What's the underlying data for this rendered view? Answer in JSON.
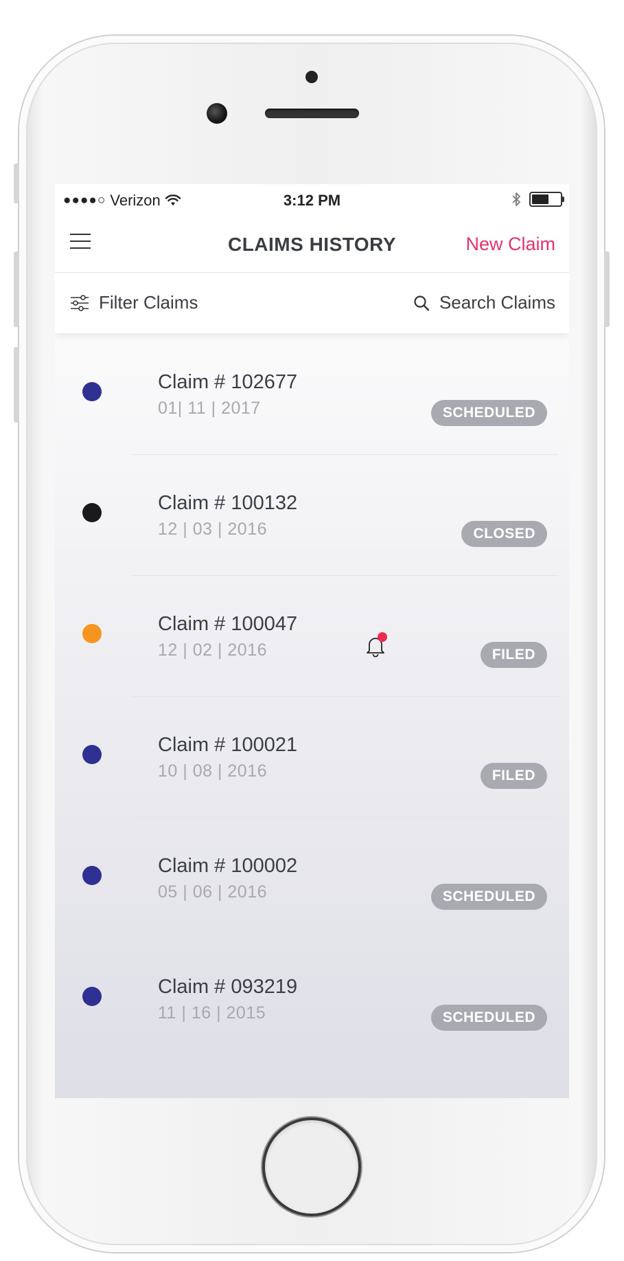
{
  "status_bar": {
    "signal_dots": "●●●●○",
    "carrier": "Verizon",
    "time": "3:12 PM",
    "icons": [
      "wifi-icon",
      "bluetooth-icon",
      "battery-icon"
    ]
  },
  "nav": {
    "title": "CLAIMS HISTORY",
    "new_claim_label": "New Claim",
    "menu_icon": "hamburger-menu-icon"
  },
  "toolbar": {
    "filter_label": "Filter Claims",
    "search_label": "Search Claims"
  },
  "colors": {
    "accent": "#e4336b",
    "indicator_blue": "#2e3192",
    "indicator_black": "#1a1a1a",
    "indicator_orange": "#f7941d",
    "badge_gray": "#a9aab1",
    "notification_red": "#ef2a50"
  },
  "claims": [
    {
      "title": "Claim # 102677",
      "date": "01| 11 | 2017",
      "status": "SCHEDULED",
      "indicator": "#2e3192",
      "has_notification": false
    },
    {
      "title": "Claim # 100132",
      "date": "12 | 03 | 2016",
      "status": "CLOSED",
      "indicator": "#1a1a1a",
      "has_notification": false
    },
    {
      "title": "Claim # 100047",
      "date": "12 | 02 | 2016",
      "status": "FILED",
      "indicator": "#f7941d",
      "has_notification": true
    },
    {
      "title": "Claim # 100021",
      "date": "10 | 08 | 2016",
      "status": "FILED",
      "indicator": "#2e3192",
      "has_notification": false
    },
    {
      "title": "Claim # 100002",
      "date": "05 | 06 | 2016",
      "status": "SCHEDULED",
      "indicator": "#2e3192",
      "has_notification": false
    },
    {
      "title": "Claim # 093219",
      "date": "11 | 16 | 2015",
      "status": "SCHEDULED",
      "indicator": "#2e3192",
      "has_notification": false
    }
  ]
}
